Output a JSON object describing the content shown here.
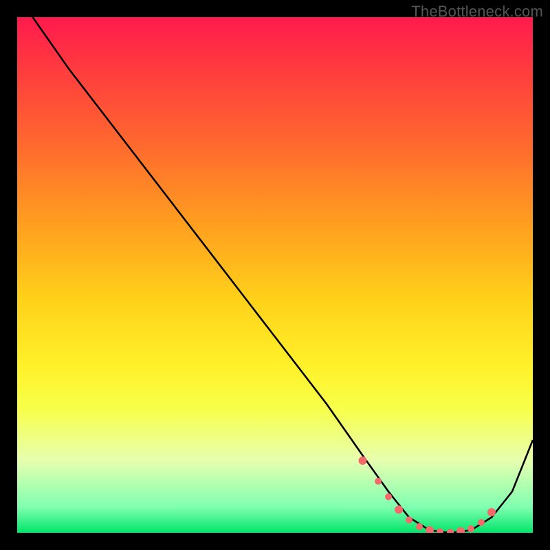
{
  "watermark": {
    "text": "TheBottleneck.com"
  },
  "chart_data": {
    "type": "line",
    "title": "",
    "xlabel": "",
    "ylabel": "",
    "xlim": [
      0,
      100
    ],
    "ylim": [
      0,
      100
    ],
    "series": [
      {
        "name": "curve",
        "x": [
          3,
          10,
          20,
          30,
          40,
          50,
          60,
          67,
          72,
          76,
          80,
          84,
          88,
          92,
          96,
          100
        ],
        "y": [
          100,
          90,
          77,
          64,
          51,
          38,
          25,
          15,
          8,
          3,
          0.5,
          0,
          0.5,
          3,
          8,
          18
        ]
      }
    ],
    "markers": {
      "name": "highlight-dots",
      "x": [
        67,
        70,
        72,
        74,
        76,
        78,
        80,
        82,
        84,
        86,
        88,
        90,
        92
      ],
      "y": [
        14,
        10,
        7,
        4.5,
        2.5,
        1.2,
        0.5,
        0.2,
        0.1,
        0.3,
        0.8,
        2,
        4
      ]
    },
    "colors": {
      "curve": "#000000",
      "markers": "#f46a6a",
      "gradient_top": "#ff1a4d",
      "gradient_bottom": "#00e56a"
    }
  }
}
